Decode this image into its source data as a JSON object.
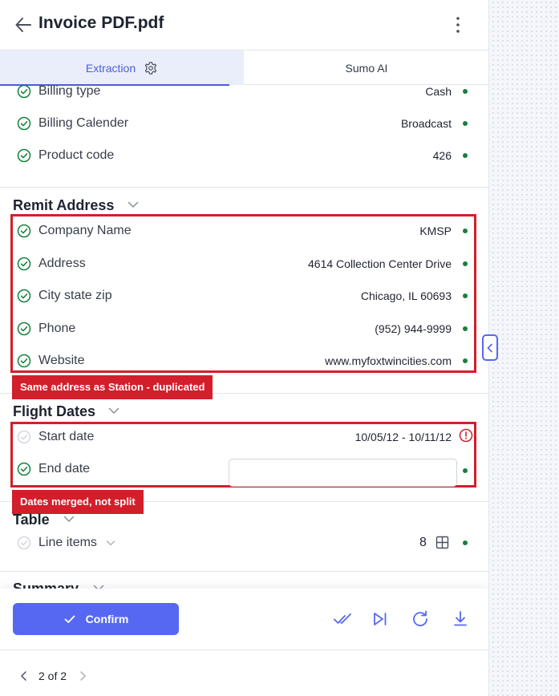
{
  "header": {
    "title": "Invoice PDF.pdf"
  },
  "tabs": [
    {
      "label": "Extraction"
    },
    {
      "label": "Sumo AI"
    }
  ],
  "top_fields": [
    {
      "label": "Billing type",
      "value": "Cash"
    },
    {
      "label": "Billing Calender",
      "value": "Broadcast"
    },
    {
      "label": "Product code",
      "value": "426"
    }
  ],
  "remit": {
    "title": "Remit Address",
    "fields": [
      {
        "label": "Company Name",
        "value": "KMSP"
      },
      {
        "label": "Address",
        "value": "4614 Collection Center Drive"
      },
      {
        "label": "City state zip",
        "value": "Chicago, IL 60693"
      },
      {
        "label": "Phone",
        "value": "(952) 944-9999"
      },
      {
        "label": "Website",
        "value": "www.myfoxtwincities.com"
      }
    ],
    "callout": "Same address as Station - duplicated"
  },
  "flight": {
    "title": "Flight Dates",
    "start": {
      "label": "Start date",
      "value": "10/05/12 - 10/11/12"
    },
    "end": {
      "label": "End date",
      "value": ""
    },
    "callout": "Dates merged, not split"
  },
  "table": {
    "title": "Table",
    "line_items": {
      "label": "Line items",
      "count": "8"
    }
  },
  "summary": {
    "title": "Summary"
  },
  "footer": {
    "confirm_label": "Confirm"
  },
  "pager": {
    "text": "2 of 2"
  },
  "colors": {
    "accent": "#5668f2",
    "callout": "#d21f2b",
    "ok": "#15803d"
  },
  "icons": [
    "back-arrow-icon",
    "kebab-menu-icon",
    "gear-icon",
    "check-circle-icon",
    "warning-icon",
    "grid-icon",
    "double-check-icon",
    "skip-icon",
    "refresh-icon",
    "download-icon",
    "chevron-left-icon",
    "chevron-right-icon"
  ]
}
